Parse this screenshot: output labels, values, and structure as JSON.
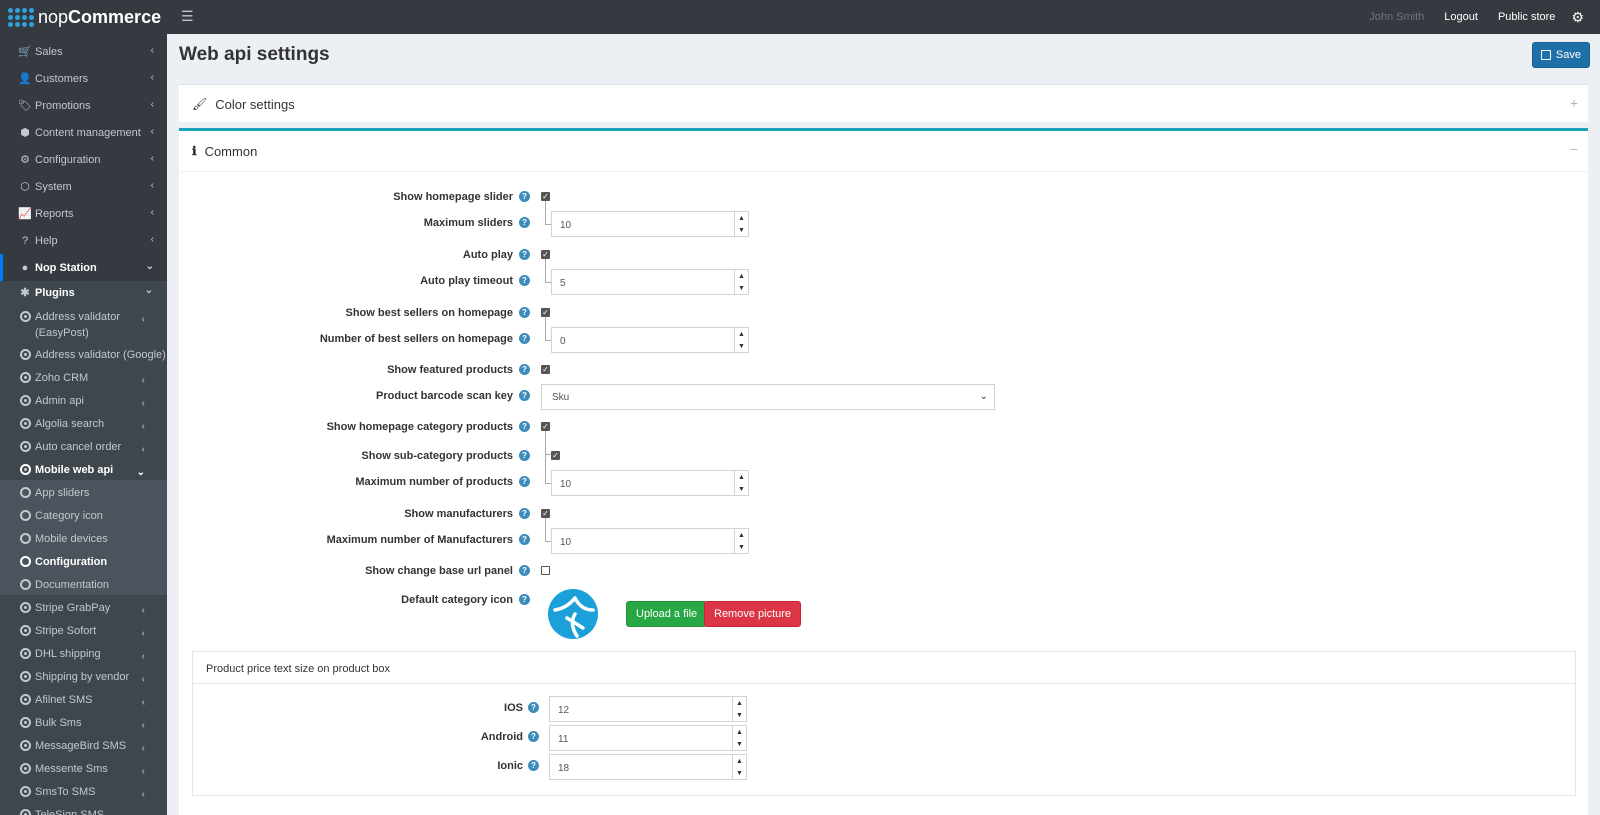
{
  "brand": {
    "name_light": "nop",
    "name_bold": "Commerce"
  },
  "header": {
    "user": "John Smith",
    "logout": "Logout",
    "public_store": "Public store"
  },
  "sidebar": {
    "main_items": [
      {
        "label": "Sales",
        "icon": "cart-icon"
      },
      {
        "label": "Customers",
        "icon": "user-icon"
      },
      {
        "label": "Promotions",
        "icon": "tags-icon"
      },
      {
        "label": "Content management",
        "icon": "cubes-icon"
      },
      {
        "label": "Configuration",
        "icon": "gears-icon"
      },
      {
        "label": "System",
        "icon": "cube-icon"
      },
      {
        "label": "Reports",
        "icon": "chart-icon"
      },
      {
        "label": "Help",
        "icon": "question-icon"
      }
    ],
    "nop_station": "Nop Station",
    "plugins": "Plugins",
    "plugin_items": [
      {
        "label": "Address validator (EasyPost)"
      },
      {
        "label": "Address validator (Google)"
      },
      {
        "label": "Zoho CRM"
      },
      {
        "label": "Admin api"
      },
      {
        "label": "Algolia search"
      },
      {
        "label": "Auto cancel order"
      }
    ],
    "mobile_web_api": "Mobile web api",
    "mobile_sub_items": [
      {
        "label": "App sliders"
      },
      {
        "label": "Category icon"
      },
      {
        "label": "Mobile devices"
      },
      {
        "label": "Configuration"
      },
      {
        "label": "Documentation"
      }
    ],
    "more_plugins": [
      {
        "label": "Stripe GrabPay"
      },
      {
        "label": "Stripe Sofort"
      },
      {
        "label": "DHL shipping"
      },
      {
        "label": "Shipping by vendor"
      },
      {
        "label": "Afilnet SMS"
      },
      {
        "label": "Bulk Sms"
      },
      {
        "label": "MessageBird SMS"
      },
      {
        "label": "Messente Sms"
      },
      {
        "label": "SmsTo SMS"
      },
      {
        "label": "TeleSign SMS"
      }
    ]
  },
  "page": {
    "title": "Web api settings",
    "save": "Save"
  },
  "color_settings": {
    "title": "Color settings"
  },
  "common": {
    "title": "Common",
    "fields": {
      "show_homepage_slider": {
        "label": "Show homepage slider",
        "checked": true
      },
      "maximum_sliders": {
        "label": "Maximum sliders",
        "value": "10"
      },
      "auto_play": {
        "label": "Auto play",
        "checked": true
      },
      "auto_play_timeout": {
        "label": "Auto play timeout",
        "value": "5"
      },
      "show_best_sellers": {
        "label": "Show best sellers on homepage",
        "checked": true
      },
      "number_best_sellers": {
        "label": "Number of best sellers on homepage",
        "value": "0"
      },
      "show_featured": {
        "label": "Show featured products",
        "checked": true
      },
      "barcode_scan_key": {
        "label": "Product barcode scan key",
        "value": "Sku"
      },
      "show_homepage_category": {
        "label": "Show homepage category products",
        "checked": true
      },
      "show_sub_category": {
        "label": "Show sub-category products",
        "checked": true
      },
      "max_products": {
        "label": "Maximum number of products",
        "value": "10"
      },
      "show_manufacturers": {
        "label": "Show manufacturers",
        "checked": true
      },
      "max_manufacturers": {
        "label": "Maximum number of Manufacturers",
        "value": "10"
      },
      "show_change_base_url": {
        "label": "Show change base url panel",
        "checked": false
      },
      "default_category_icon": {
        "label": "Default category icon"
      }
    },
    "upload": "Upload a file",
    "remove": "Remove picture",
    "price_panel": {
      "title": "Product price text size on product box",
      "ios": {
        "label": "IOS",
        "value": "12"
      },
      "android": {
        "label": "Android",
        "value": "11"
      },
      "ionic": {
        "label": "Ionic",
        "value": "18"
      }
    }
  },
  "colors": {
    "sidebar": "#343a40",
    "accent": "#17a2b8",
    "save": "#1f6fa8",
    "upload": "#28a745",
    "remove": "#dc3545"
  }
}
